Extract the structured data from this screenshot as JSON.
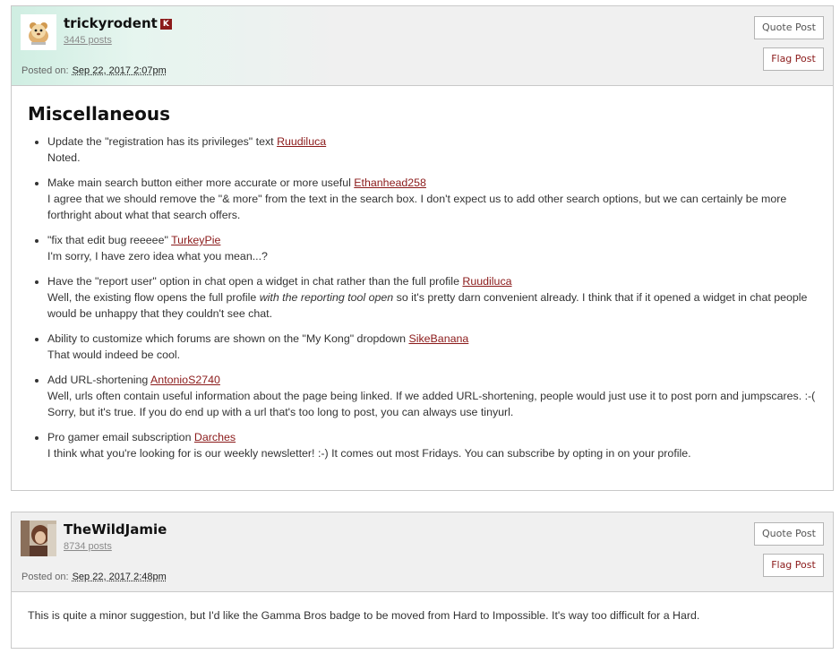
{
  "posts": [
    {
      "username": "trickyrodent",
      "badge": "K",
      "posts_count": "3445 posts",
      "posted_on_label": "Posted on:",
      "posted_date": "Sep 22, 2017 2:07pm",
      "quote_label": "Quote Post",
      "flag_label": "Flag Post",
      "section_title": "Miscellaneous",
      "items": [
        {
          "suggestion": "Update the \"registration has its privileges\" text",
          "user": "Ruudiluca",
          "reply": "Noted."
        },
        {
          "suggestion": "Make main search button either more accurate or more useful",
          "user": "Ethanhead258",
          "reply": "I agree that we should remove the \"& more\" from the text in the search box. I don't expect us to add other search options, but we can certainly be more forthright about what that search offers."
        },
        {
          "suggestion": "\"fix that edit bug reeeee\"",
          "user": "TurkeyPie",
          "reply": "I'm sorry, I have zero idea what you mean...?"
        },
        {
          "suggestion": "Have the \"report user\" option in chat open a widget in chat rather than the full profile",
          "user": "Ruudiluca",
          "reply_before": "Well, the existing flow opens the full profile ",
          "reply_em": "with the reporting tool open",
          "reply_after": " so it's pretty darn convenient already. I think that if it opened a widget in chat people would be unhappy that they couldn't see chat."
        },
        {
          "suggestion": "Ability to customize which forums are shown on the \"My Kong\" dropdown",
          "user": "SikeBanana",
          "reply": "That would indeed be cool."
        },
        {
          "suggestion": "Add URL-shortening",
          "user": "AntonioS2740",
          "reply": "Well, urls often contain useful information about the page being linked. If we added URL-shortening, people would just use it to post porn and jumpscares. :-( Sorry, but it's true. If you do end up with a url that's too long to post, you can always use tinyurl."
        },
        {
          "suggestion": "Pro gamer email subscription",
          "user": "Darches",
          "reply": "I think what you're looking for is our weekly newsletter! :-) It comes out most Fridays. You can subscribe by opting in on your profile."
        }
      ]
    },
    {
      "username": "TheWildJamie",
      "posts_count": "8734 posts",
      "posted_on_label": "Posted on:",
      "posted_date": "Sep 22, 2017 2:48pm",
      "quote_label": "Quote Post",
      "flag_label": "Flag Post",
      "body": "This is quite a minor suggestion, but I'd like the Gamma Bros badge to be moved from Hard to Impossible. It's way too difficult for a Hard."
    }
  ]
}
